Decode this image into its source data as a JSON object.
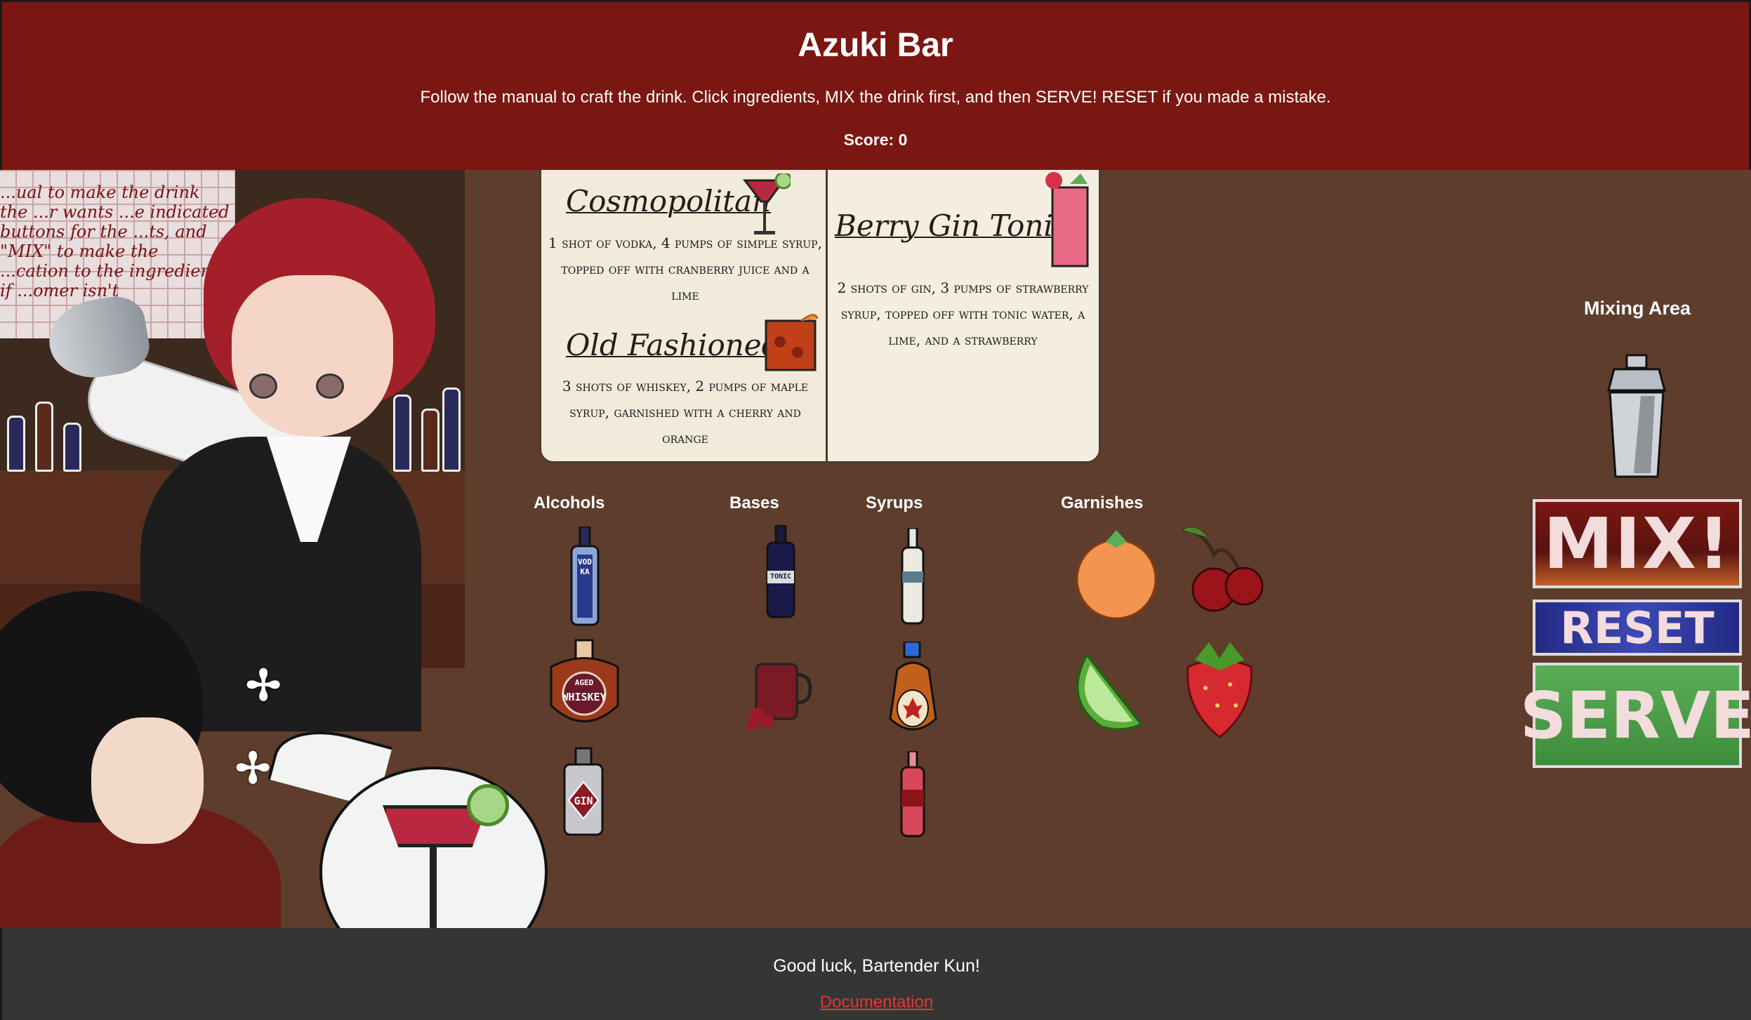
{
  "header": {
    "title": "Azuki Bar",
    "instructions": "Follow the manual to craft the drink. Click ingredients, MIX the drink first, and then SERVE! RESET if you made a mistake.",
    "score": "Score: 0"
  },
  "scene": {
    "sign_text": "...ual to make the drink the ...r wants ...e indicated buttons for the ...ts, and \"MIX\" to make the ...cation to the ingredients if ...omer isn't"
  },
  "manual": {
    "recipes": [
      {
        "name": "Cosmopolitan",
        "text": "1 shot of vodka, 4 pumps of simple syrup, topped off with cranberry juice and a lime"
      },
      {
        "name": "Old Fashioned",
        "text": "3 shots of whiskey, 2 pumps of maple syrup, garnished with a cherry and orange"
      },
      {
        "name": "Berry Gin Tonic",
        "text": "2 shots of gin, 3 pumps of strawberry syrup, topped off with tonic water, a lime, and a strawberry"
      }
    ]
  },
  "categories": {
    "alcohols": "Alcohols",
    "bases": "Bases",
    "syrups": "Syrups",
    "garnishes": "Garnishes"
  },
  "ingredients": {
    "vodka_label": "VODKA",
    "whiskey_label_top": "AGED",
    "whiskey_label": "WHISKEY",
    "gin_label": "GIN",
    "tonic_label": "TONIC"
  },
  "mixing": {
    "title": "Mixing Area",
    "mix_label": "MIX!",
    "reset_label": "RESET",
    "serve_label": "SERVE"
  },
  "footer": {
    "message": "Good luck, Bartender Kun!",
    "link": "Documentation"
  },
  "colors": {
    "header_bg": "#7a1712",
    "game_bg": "#5e3d2d",
    "footer_bg": "#353535",
    "link": "#e03a2e"
  }
}
